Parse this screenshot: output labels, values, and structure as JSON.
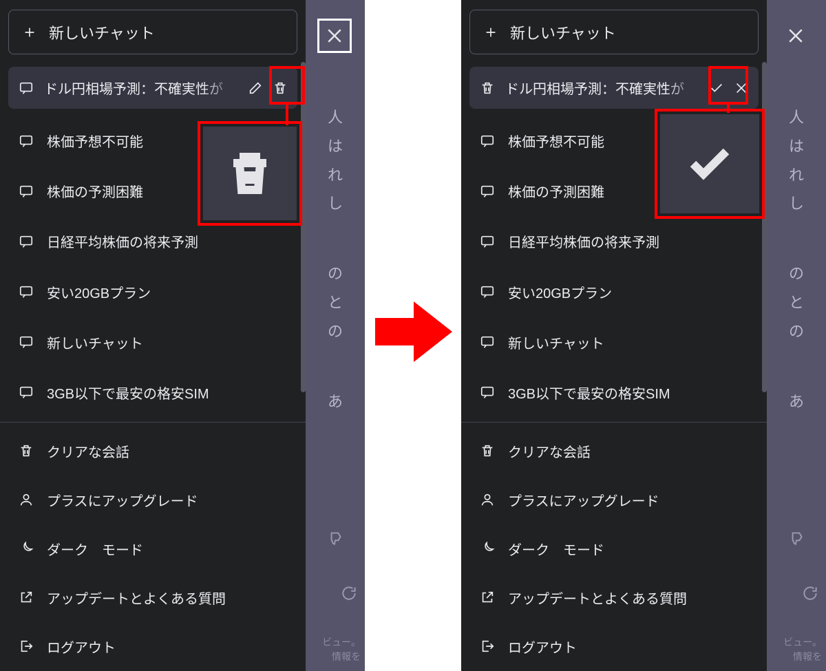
{
  "common": {
    "new_chat": "新しいチャット",
    "selected_chat_title": "ドル円相場予測：不確実性が",
    "chats": [
      "株価予想不可能",
      "株価の予測困難",
      "日経平均株価の将来予測",
      "安い20GBプラン",
      "新しいチャット",
      "3GB以下で最安の格安SIM"
    ],
    "menu": {
      "clear": "クリアな会話",
      "upgrade": "プラスにアップグレード",
      "dark": "ダーク　モード",
      "faq": "アップデートとよくある質問",
      "logout": "ログアウト"
    }
  },
  "bg": {
    "t1": "人",
    "t2": "は",
    "t3": "れ",
    "t4": "し",
    "m1": "の",
    "m2": "と",
    "m3": "の",
    "b1": "あ",
    "foot1": "ビュー。",
    "foot2": "情報を"
  }
}
